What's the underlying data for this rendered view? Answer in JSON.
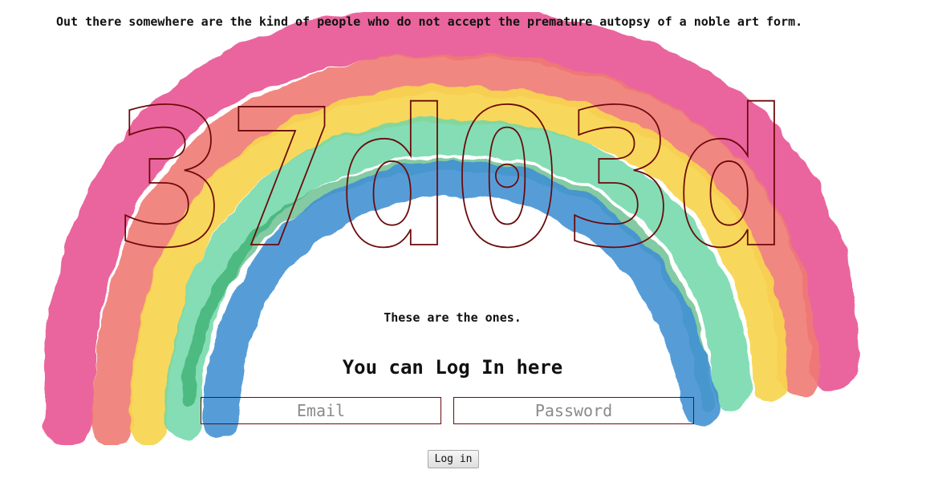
{
  "tagline": "Out there somewhere are the kind of people who do not accept the premature autopsy of a noble art form.",
  "logo_text": "37d03d",
  "subtitle": "These are the ones.",
  "login": {
    "heading": "You can Log In here",
    "email_placeholder": "Email",
    "password_placeholder": "Password",
    "button_label": "Log in"
  },
  "colors": {
    "logo_outline": "#6b0a0a",
    "rainbow": [
      "#e7508f",
      "#f07a73",
      "#f7d54e",
      "#6fd7a8",
      "#3f8fd3"
    ]
  }
}
